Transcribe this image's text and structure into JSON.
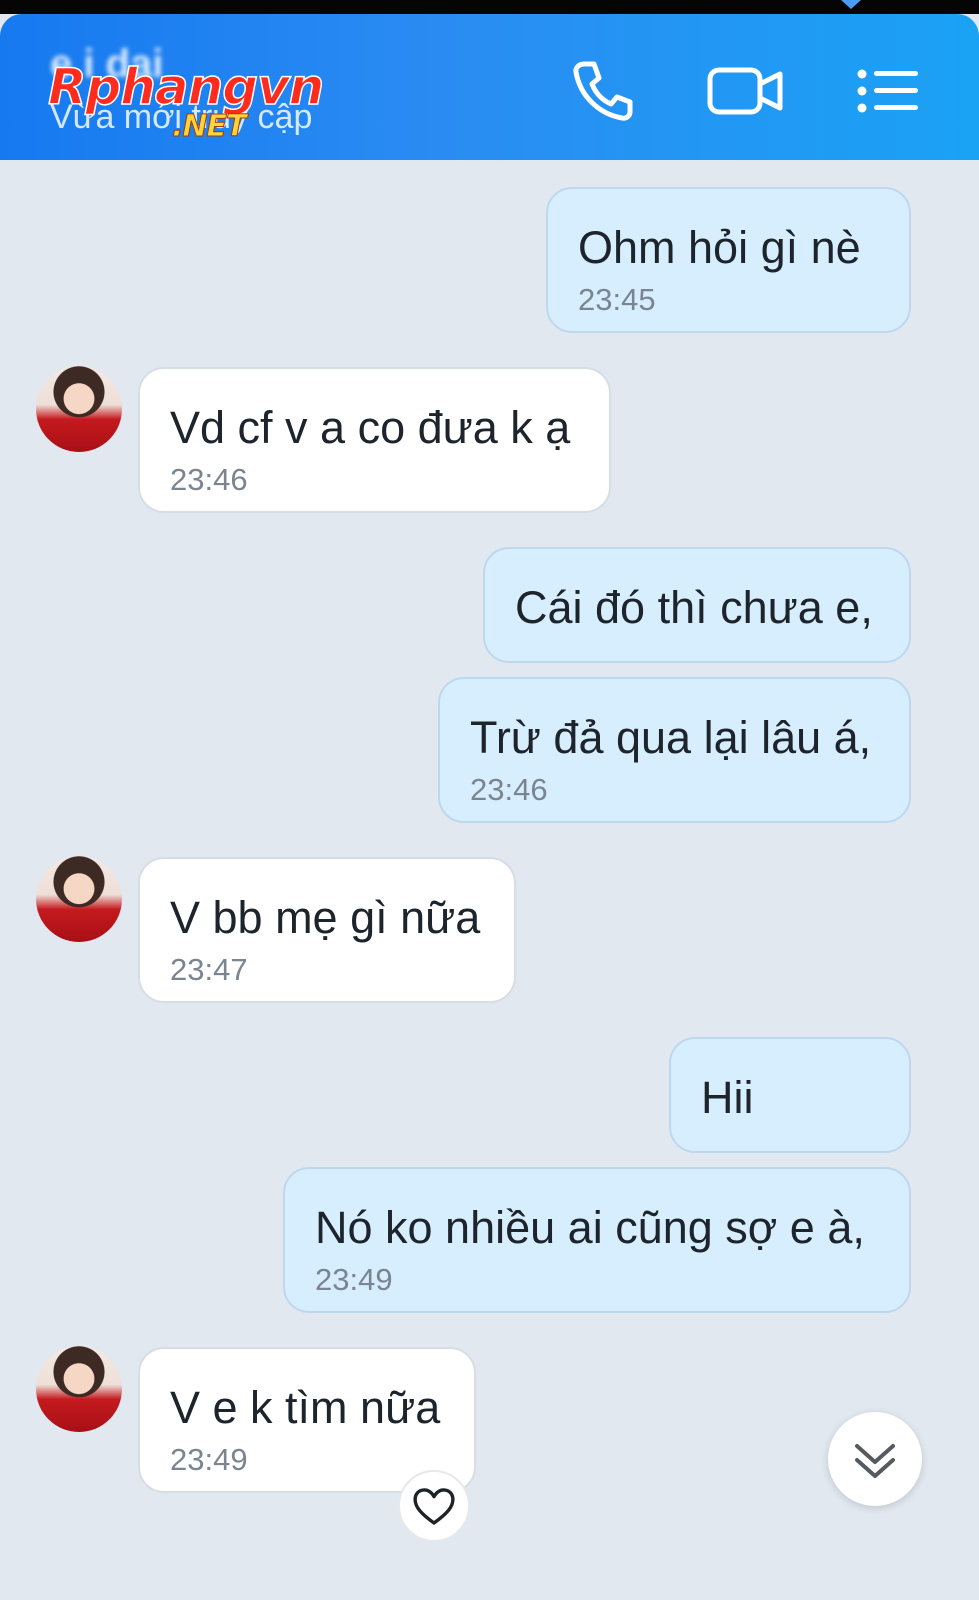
{
  "header": {
    "contact_name": "e i dai",
    "status": "Vừa mới truy cập",
    "watermark": {
      "main": "Rphangvn",
      "sub": ".NET"
    },
    "icons": [
      "phone-icon",
      "video-call-icon",
      "menu-list-icon"
    ],
    "accent_color": "#1679f0"
  },
  "messages": [
    {
      "side": "me",
      "lines": [
        "Ohm hỏi gì nè"
      ],
      "time": "23:45"
    },
    {
      "side": "them",
      "lines": [
        "Vd cf v a co đưa k ạ"
      ],
      "time": "23:46"
    },
    {
      "side": "me",
      "lines": [
        "Cái đó thì chưa e,"
      ],
      "time": ""
    },
    {
      "side": "me",
      "lines": [
        "Trừ đả qua lại lâu á,"
      ],
      "time": "23:46"
    },
    {
      "side": "them",
      "lines": [
        "V bb mẹ gì nữa"
      ],
      "time": "23:47"
    },
    {
      "side": "me",
      "lines": [
        "Hii"
      ],
      "time": ""
    },
    {
      "side": "me",
      "lines": [
        "Nó ko nhiều ai cũng sợ e à,"
      ],
      "time": "23:49"
    },
    {
      "side": "them",
      "lines": [
        "V e k tìm nữa"
      ],
      "time": "23:49"
    }
  ],
  "controls": {
    "scroll_down": "chevron-double-down-icon",
    "react": "heart-icon"
  },
  "colors": {
    "my_bubble": "#d7eeff",
    "their_bubble": "#ffffff",
    "background": "#e2e8f0"
  }
}
